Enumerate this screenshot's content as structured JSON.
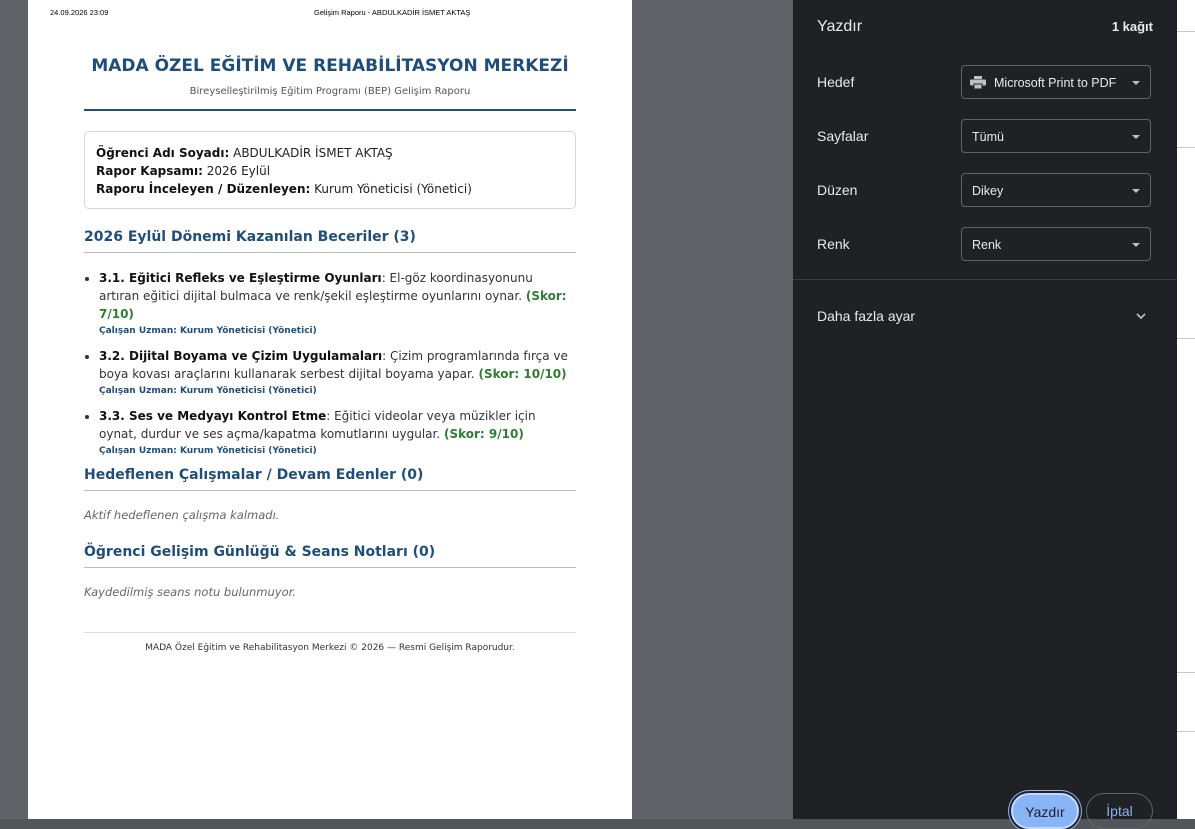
{
  "print_page": {
    "header_date": "24.09.2026 23:09",
    "header_doc": "Gelişim Raporu - ABDULKADİR İSMET AKTAŞ",
    "title": "MADA ÖZEL EĞİTİM VE REHABİLİTASYON MERKEZİ",
    "subtitle": "Bireyselleştirilmiş Eğitim Programı (BEP) Gelişim Raporu",
    "info": {
      "student_label": "Öğrenci Adı Soyadı:",
      "student_value": "ABDULKADİR İSMET AKTAŞ",
      "scope_label": "Rapor Kapsamı:",
      "scope_value": "2026 Eylül",
      "reviewer_label": "Raporu İnceleyen / Düzenleyen:",
      "reviewer_value": "Kurum Yöneticisi (Yönetici)"
    },
    "skills_heading": "2026 Eylül Dönemi Kazanılan Beceriler (3)",
    "skills": [
      {
        "name": "3.1. Eğitici Refleks ve Eşleştirme Oyunları",
        "desc": ": El-göz koordinasyonunu artıran eğitici dijital bulmaca ve renk/şekil eşleştirme oyunlarını oynar.",
        "score": "(Skor: 7/10)",
        "expert": "Çalışan Uzman: Kurum Yöneticisi (Yönetici)"
      },
      {
        "name": "3.2. Dijital Boyama ve Çizim Uygulamaları",
        "desc": ": Çizim programlarında fırça ve boya kovası araçlarını kullanarak serbest dijital boyama yapar.",
        "score": "(Skor: 10/10)",
        "expert": "Çalışan Uzman: Kurum Yöneticisi (Yönetici)"
      },
      {
        "name": "3.3. Ses ve Medyayı Kontrol Etme",
        "desc": ": Eğitici videolar veya müzikler için oynat, durdur ve ses açma/kapatma komutlarını uygular.",
        "score": "(Skor: 9/10)",
        "expert": "Çalışan Uzman: Kurum Yöneticisi (Yönetici)"
      }
    ],
    "goals_heading": "Hedeflenen Çalışmalar / Devam Edenler (0)",
    "goals_empty": "Aktif hedeflenen çalışma kalmadı.",
    "notes_heading": "Öğrenci Gelişim Günlüğü & Seans Notları (0)",
    "notes_empty": "Kaydedilmiş seans notu bulunmuyor.",
    "footer": "MADA Özel Eğitim ve Rehabilitasyon Merkezi © 2026 — Resmi Gelişim Raporudur."
  },
  "dialog": {
    "title": "Yazdır",
    "sheet_count": "1 kağıt",
    "destination_label": "Hedef",
    "destination_value": "Microsoft Print to PDF",
    "pages_label": "Sayfalar",
    "pages_value": "Tümü",
    "layout_label": "Düzen",
    "layout_value": "Dikey",
    "color_label": "Renk",
    "color_value": "Renk",
    "more_settings": "Daha fazla ayar",
    "print_button": "Yazdır",
    "cancel_button": "İptal"
  },
  "colors": {
    "dialog_bg": "#202124",
    "accent": "#8ab4f8",
    "title_blue": "#1f4e79",
    "score_green": "#2e7d32"
  }
}
